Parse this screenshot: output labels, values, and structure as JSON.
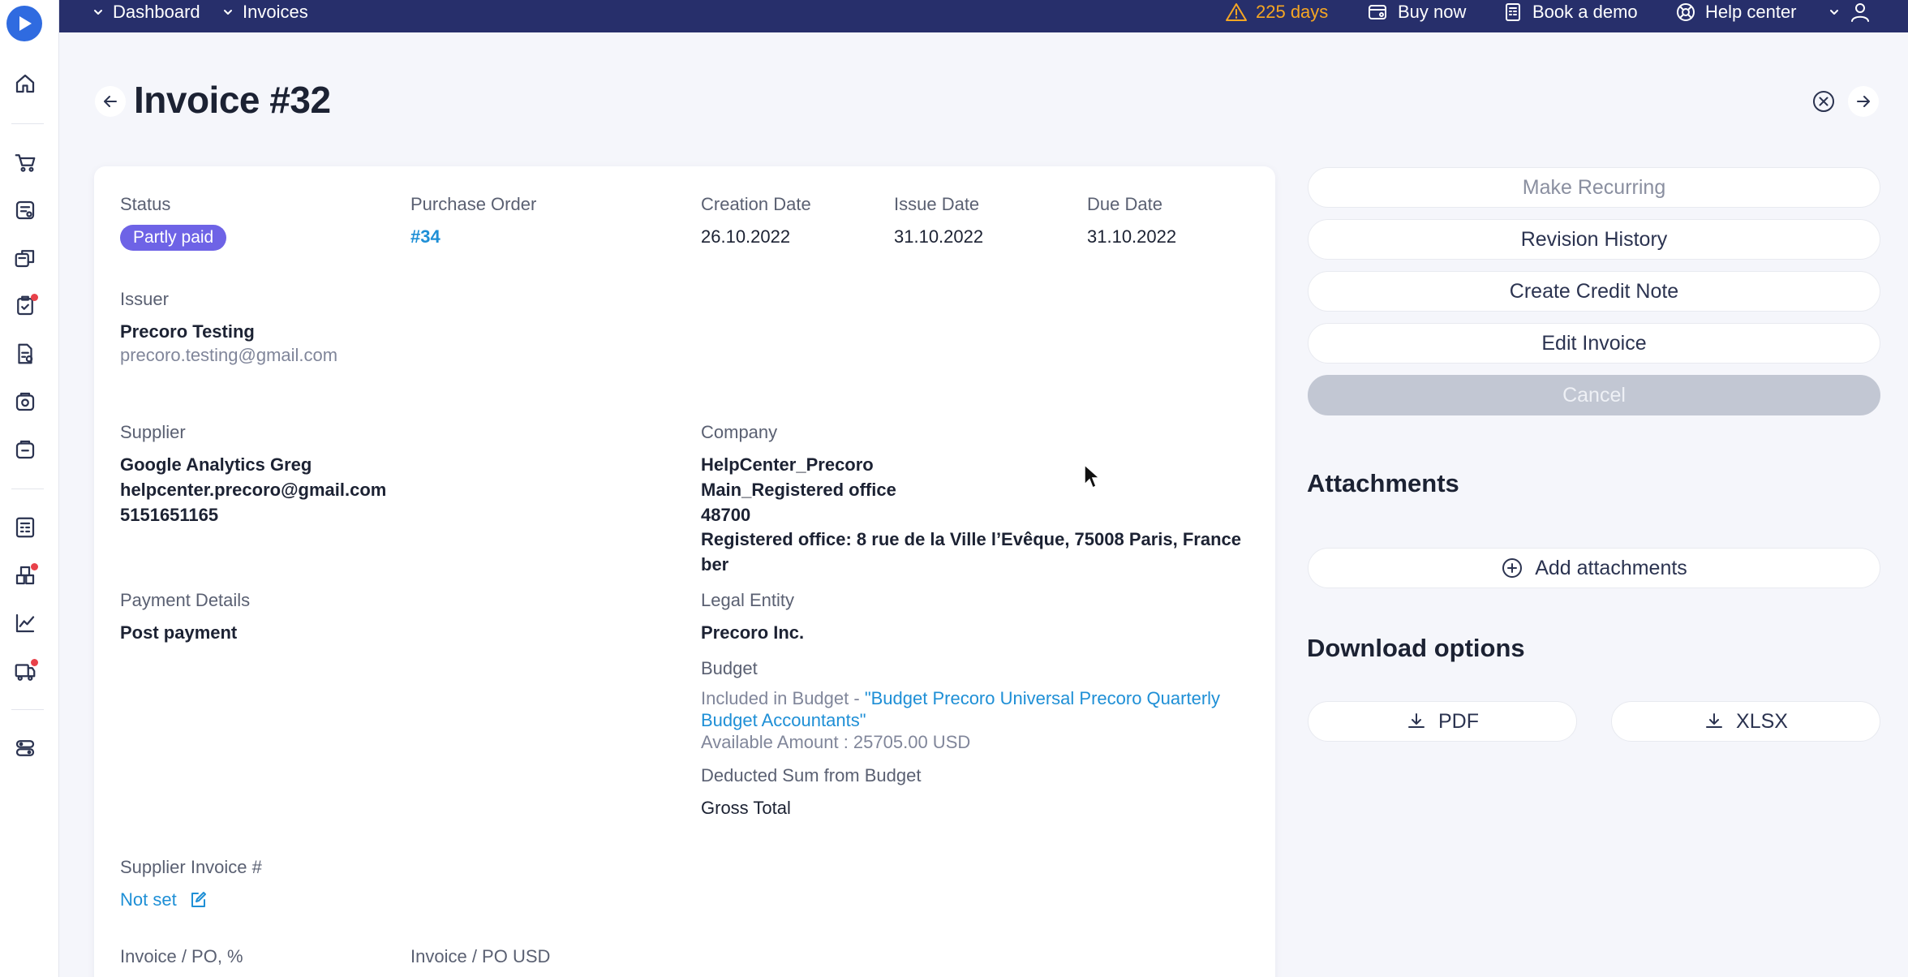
{
  "topbar": {
    "breadcrumb": [
      {
        "label": "Dashboard"
      },
      {
        "label": "Invoices"
      }
    ],
    "trial": "225 days",
    "buy_now": "Buy now",
    "book_demo": "Book a demo",
    "help_center": "Help center"
  },
  "page": {
    "title": "Invoice #32"
  },
  "invoice": {
    "status_label": "Status",
    "status_value": "Partly paid",
    "po_label": "Purchase Order",
    "po_value": "#34",
    "creation_label": "Creation Date",
    "creation_value": "26.10.2022",
    "issue_label": "Issue Date",
    "issue_value": "31.10.2022",
    "due_label": "Due Date",
    "due_value": "31.10.2022",
    "issuer_label": "Issuer",
    "issuer_name": "Precoro Testing",
    "issuer_email": "precoro.testing@gmail.com",
    "supplier_label": "Supplier",
    "supplier_name": "Google Analytics Greg",
    "supplier_email": "helpcenter.precoro@gmail.com",
    "supplier_phone": "5151651165",
    "company_label": "Company",
    "company_name": "HelpCenter_Precoro",
    "company_office": "Main_Registered office",
    "company_zip": "48700",
    "company_address_1": "Registered office: 8 rue de la Ville l’Evêque, 75008 Paris, France",
    "company_address_2": "ber",
    "payment_label": "Payment Details",
    "payment_value": "Post payment",
    "legal_label": "Legal Entity",
    "legal_value": "Precoro Inc.",
    "budget_label": "Budget",
    "budget_prefix": "Included in Budget - ",
    "budget_link_1": "\"Budget Precoro Universal Precoro Quarterly",
    "budget_link_2": "Budget Accountants\"",
    "budget_available": "Available Amount : 25705.00 USD",
    "deducted_label": "Deducted Sum from Budget",
    "deducted_value": "Gross Total",
    "supplier_invoice_label": "Supplier Invoice #",
    "supplier_invoice_value": "Not set",
    "inv_po_pct_label": "Invoice / PO, %",
    "inv_po_usd_label": "Invoice / PO USD"
  },
  "actions": {
    "make_recurring": "Make Recurring",
    "revision_history": "Revision History",
    "create_credit_note": "Create Credit Note",
    "edit_invoice": "Edit Invoice",
    "cancel": "Cancel"
  },
  "attachments": {
    "title": "Attachments",
    "add": "Add attachments"
  },
  "downloads": {
    "title": "Download options",
    "pdf": "PDF",
    "xlsx": "XLSX"
  },
  "colors": {
    "topbar": "#272f6b",
    "badge": "#6e63e6",
    "link": "#1e8fd6",
    "trial": "#f5a623"
  }
}
